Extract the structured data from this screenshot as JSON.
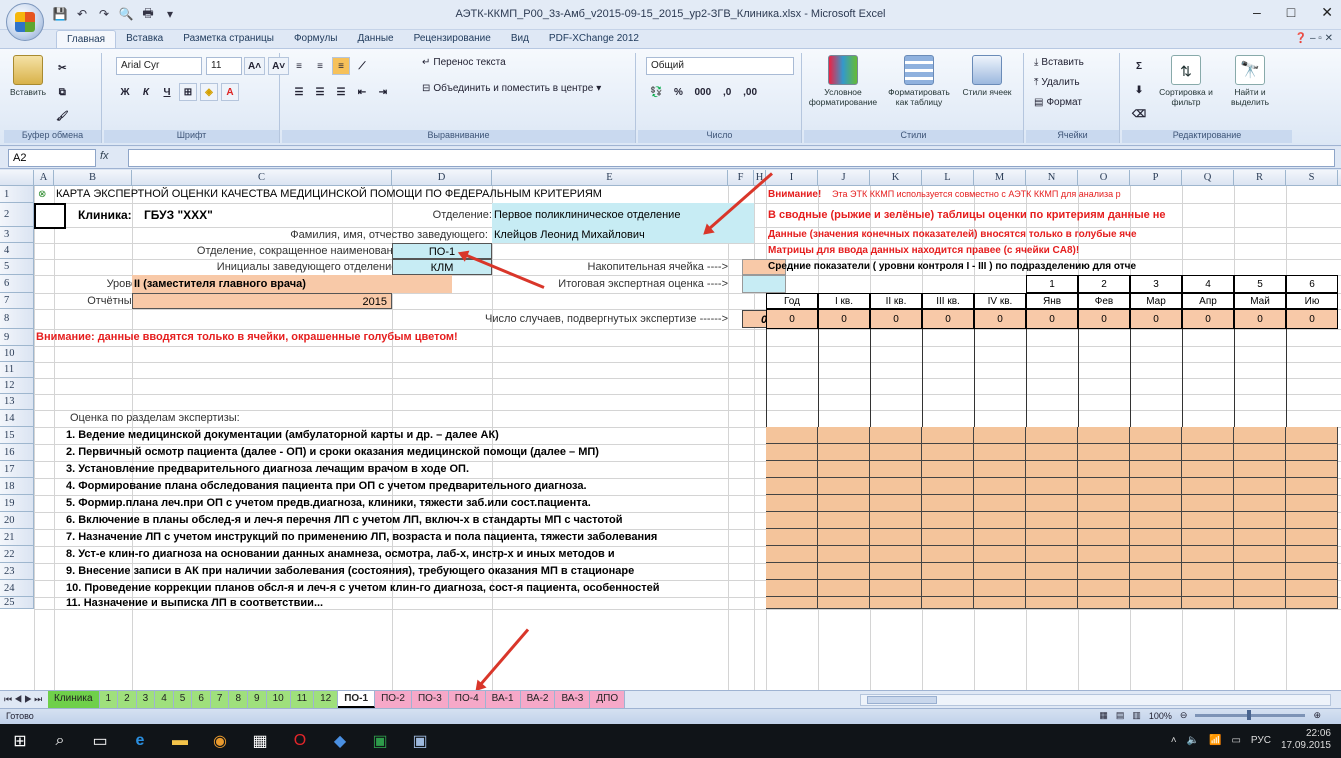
{
  "window": {
    "title": "АЭТК-ККМП_Р00_3з-Амб_v2015-09-15_2015_ур2-ЗГВ_Клиника.xlsx - Microsoft Excel",
    "controls": [
      "–",
      "□",
      "✕"
    ]
  },
  "ribbon_tabs": [
    "Главная",
    "Вставка",
    "Разметка страницы",
    "Формулы",
    "Данные",
    "Рецензирование",
    "Вид",
    "PDF-XChange 2012"
  ],
  "ribbon": {
    "clipboard": {
      "paste": "Вставить",
      "label": "Буфер обмена"
    },
    "font": {
      "name": "Arial Cyr",
      "size": "11",
      "label": "Шрифт"
    },
    "alignment": {
      "wrap": "Перенос текста",
      "merge": "Объединить и поместить в центре",
      "label": "Выравнивание"
    },
    "number": {
      "format": "Общий",
      "label": "Число"
    },
    "styles": {
      "conditional": "Условное форматирование",
      "as_table": "Форматировать как таблицу",
      "cell_styles": "Стили ячеек",
      "label": "Стили"
    },
    "cells": {
      "insert": "Вставить",
      "delete": "Удалить",
      "format": "Формат",
      "label": "Ячейки"
    },
    "editing": {
      "sort": "Сортировка и фильтр",
      "find": "Найти и выделить",
      "label": "Редактирование"
    }
  },
  "formula_bar": {
    "name_box": "A2",
    "fx": "fx",
    "value": ""
  },
  "columns": [
    "A",
    "B",
    "C",
    "D",
    "E",
    "F",
    "H",
    "I",
    "J",
    "K",
    "L",
    "M",
    "N",
    "O",
    "P",
    "Q",
    "R",
    "S"
  ],
  "rows": [
    "1",
    "2",
    "3",
    "4",
    "5",
    "6",
    "7",
    "8",
    "9",
    "10",
    "11",
    "12",
    "13",
    "14",
    "15",
    "16",
    "17",
    "18",
    "19",
    "20",
    "21",
    "22",
    "23",
    "24",
    "25"
  ],
  "cells": {
    "r1": "КАРТА ЭКСПЕРТНОЙ ОЦЕНКИ КАЧЕСТВА МЕДИЦИНСКОЙ ПОМОЩИ ПО ФЕДЕРАЛЬНЫМ КРИТЕРИЯМ",
    "r2_label": "Клиника:",
    "r2_value": "ГБУЗ \"XXX\"",
    "r2_dept_label": "Отделение:",
    "r2_dept_value": "Первое поликлиническое отделение",
    "r3_label": "Фамилия, имя, отчество заведующего:",
    "r3_value": "Клейцов Леонид Михайлович",
    "r4_label": "Отделение, сокращенное наименование:",
    "r4_value": "ПО-1",
    "r5_label": "Инициалы заведующего отделением:",
    "r5_value": "КЛМ",
    "r5_acc": "Накопительная ячейка ---->",
    "r6_label": "Уровень:",
    "r6_value": "II (заместителя главного врача)",
    "r6_final": "Итоговая экспертная оценка ---->",
    "r7_label": "Отчётный год:",
    "r7_value": "2015",
    "r8_label": "Число случаев, подвергнутых экспертизе ------>",
    "r8_value": "0",
    "r9": "Внимание: данные вводятся только в ячейки, окрашенные голубым цветом!",
    "r14": "Оценка по разделам экспертизы:",
    "r15": "1. Ведение медицинской документации (амбулаторной карты и др. – далее АК)",
    "r16": "2. Первичный осмотр пациента (далее - ОП) и сроки оказания медицинской помощи (далее – МП)",
    "r17": "3. Установление предварительного диагноза лечащим врачом в ходе ОП.",
    "r18": "4. Формирование плана обследования пациента при ОП с учетом предварительного диагноза.",
    "r19": "5. Формир.плана леч.при ОП с  учетом предв.диагноза, клиники, тяжести заб.или сост.пациента.",
    "r20": "6. Включение в планы обслед-я и леч-я перечня ЛП с учетом ЛП, включ-х в стандарты МП с частотой",
    "r21": "7. Назначение ЛП с учетом инструкций по применению ЛП, возраста и пола пациента, тяжести заболевания",
    "r22": "8. Уст-е клин-го диагноза на основании данных анамнеза, осмотра, лаб-х, инстр-х и иных методов и",
    "r23": "9. Внесение записи в АК при наличии заболевания (состояния), требующего оказания МП в стационаре",
    "r24": "10. Проведение коррекции планов обсл-я и леч-я с учетом клин-го диагноза, сост-я пациента, особенностей",
    "r25": "11. Назначение и выписка ЛП в соответствии..."
  },
  "right_panel": {
    "r1_attention": "Внимание!",
    "r1_text": "Эта ЭТК ККМП используется совместно с АЭТК ККМП для анализа р",
    "r2": "В сводные (рыжие и зелёные) таблицы оценки по критериям данные не",
    "r3": "Данные (значения конечных показателей) вносятся только в голубые яче",
    "r4": "Матрицы для ввода данных находится правее (с ячейки CA8)!",
    "r5": "Средние показатели ( уровни контроля I - III ) по подразделению для отче",
    "month_numbers": [
      "1",
      "2",
      "3",
      "4",
      "5",
      "6"
    ],
    "headers": [
      "Год",
      "I кв.",
      "II кв.",
      "III кв.",
      "IV кв.",
      "Янв",
      "Фев",
      "Мар",
      "Апр",
      "Май",
      "Ию"
    ],
    "values": [
      "0",
      "0",
      "0",
      "0",
      "0",
      "0",
      "0",
      "0",
      "0",
      "0",
      "0"
    ]
  },
  "sheet_tabs": [
    {
      "label": "Клиника",
      "color": "#6fd04a"
    },
    {
      "label": "1",
      "color": "#9fe07c"
    },
    {
      "label": "2",
      "color": "#9fe07c"
    },
    {
      "label": "3",
      "color": "#9fe07c"
    },
    {
      "label": "4",
      "color": "#9fe07c"
    },
    {
      "label": "5",
      "color": "#9fe07c"
    },
    {
      "label": "6",
      "color": "#9fe07c"
    },
    {
      "label": "7",
      "color": "#9fe07c"
    },
    {
      "label": "8",
      "color": "#9fe07c"
    },
    {
      "label": "9",
      "color": "#9fe07c"
    },
    {
      "label": "10",
      "color": "#9fe07c"
    },
    {
      "label": "11",
      "color": "#9fe07c"
    },
    {
      "label": "12",
      "color": "#9fe07c"
    },
    {
      "label": "ПО-1",
      "color": "#ffffff"
    },
    {
      "label": "ПО-2",
      "color": "#f6a8c8"
    },
    {
      "label": "ПО-3",
      "color": "#f6a8c8"
    },
    {
      "label": "ПО-4",
      "color": "#f6a8c8"
    },
    {
      "label": "ВА-1",
      "color": "#f6a8c8"
    },
    {
      "label": "ВА-2",
      "color": "#f6a8c8"
    },
    {
      "label": "ВА-3",
      "color": "#f6a8c8"
    },
    {
      "label": "ДПО",
      "color": "#f6a8c8"
    }
  ],
  "status": {
    "ready": "Готово",
    "zoom": "100%"
  },
  "taskbar": {
    "lang": "РУС",
    "time": "22:06",
    "date": "17.09.2015"
  },
  "colors": {
    "accent_blue": "#c7ecf4",
    "peach": "#f8c9a8",
    "red_text": "#e51e1e",
    "arrow": "#d9362a"
  }
}
